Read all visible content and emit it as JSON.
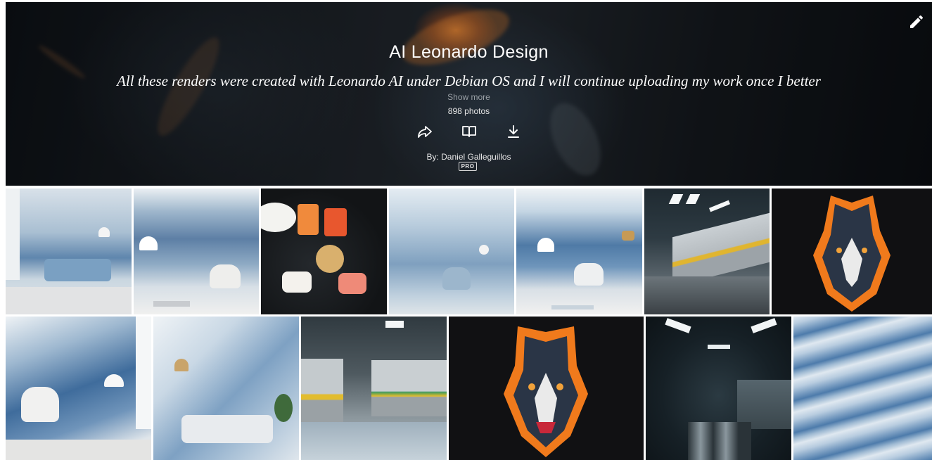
{
  "album": {
    "title": "AI Leonardo Design",
    "description": "All these renders were created with Leonardo AI under Debian OS and I will continue uploading my work once I better",
    "show_more_label": "Show more",
    "photo_count": "898 photos",
    "byline": "By: Daniel Galleguillos",
    "badge": "PRO"
  },
  "actions": {
    "edit_icon": "pencil-icon",
    "share_icon": "share-icon",
    "slideshow_icon": "book-icon",
    "download_icon": "download-icon"
  },
  "colors": {
    "hero_text": "#ffffff",
    "muted_text": "#9aa0a6",
    "flame_orange": "#f07a1c"
  },
  "photos": [
    {
      "subject": "blue living room with sofa"
    },
    {
      "subject": "blue wave wall with white chair"
    },
    {
      "subject": "sushi platter with drinks"
    },
    {
      "subject": "blue wall with armchair and lamp"
    },
    {
      "subject": "blue gradient room with armchair"
    },
    {
      "subject": "subway station train"
    },
    {
      "subject": "fire wolf illustration"
    },
    {
      "subject": "blue wave wall with white chair"
    },
    {
      "subject": "blue living room with sofa and plant"
    },
    {
      "subject": "subway train platform"
    },
    {
      "subject": "fire wolf illustration"
    },
    {
      "subject": "dark subway tunnel"
    },
    {
      "subject": "blue wave texture"
    }
  ]
}
